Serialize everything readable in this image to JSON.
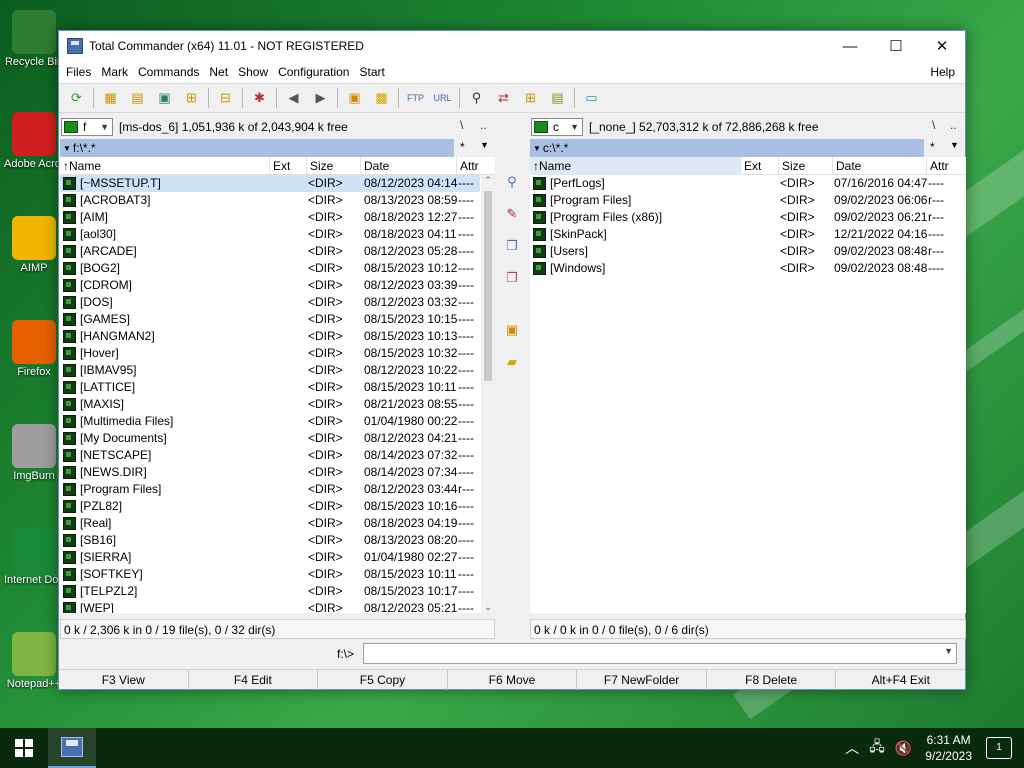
{
  "desktop": {
    "icons": [
      {
        "label": "Recycle Bin",
        "color": "#2f7d32"
      },
      {
        "label": "Adobe Acrobat",
        "color": "#d11f1f"
      },
      {
        "label": "AIMP",
        "color": "#f2b600"
      },
      {
        "label": "Firefox",
        "color": "#e66000"
      },
      {
        "label": "ImgBurn",
        "color": "#9e9e9e"
      },
      {
        "label": "Internet Download",
        "color": "#1a8a3a"
      },
      {
        "label": "Notepad++",
        "color": "#7fb542"
      }
    ]
  },
  "window": {
    "title": "Total Commander (x64) 11.01 - NOT REGISTERED",
    "controls": {
      "minimize": "—",
      "maximize": "☐",
      "close": "✕"
    }
  },
  "menu": {
    "items": [
      "Files",
      "Mark",
      "Commands",
      "Net",
      "Show",
      "Configuration",
      "Start"
    ],
    "help": "Help"
  },
  "toolbar": {
    "icons": [
      "refresh-icon",
      "brief-view-icon",
      "full-view-icon",
      "thumbnails-icon",
      "tree-icon",
      "invert-selection-icon",
      "compare-dirs-icon",
      "back-icon",
      "forward-icon",
      "pack-icon",
      "unpack-icon",
      "ftp-icon",
      "url-icon",
      "search-icon",
      "sync-dirs-icon",
      "multi-rename-icon",
      "copy-names-icon",
      "notepad-icon"
    ]
  },
  "left_panel": {
    "drive": "f",
    "drive_info": "[ms-dos_6]  1,051,936 k of 2,043,904 k free",
    "root_btn": "\\",
    "up_btn": "..",
    "path": "f:\\*.*",
    "filter": "*",
    "columns": {
      "name": "Name",
      "ext": "Ext",
      "size": "Size",
      "date": "Date",
      "attr": "Attr"
    },
    "files": [
      {
        "name": "[~MSSETUP.T]",
        "size": "<DIR>",
        "date": "08/12/2023 04:14",
        "attr": "----"
      },
      {
        "name": "[ACROBAT3]",
        "size": "<DIR>",
        "date": "08/13/2023 08:59",
        "attr": "----"
      },
      {
        "name": "[AIM]",
        "size": "<DIR>",
        "date": "08/18/2023 12:27",
        "attr": "----"
      },
      {
        "name": "[aol30]",
        "size": "<DIR>",
        "date": "08/18/2023 04:11",
        "attr": "----"
      },
      {
        "name": "[ARCADE]",
        "size": "<DIR>",
        "date": "08/12/2023 05:28",
        "attr": "----"
      },
      {
        "name": "[BOG2]",
        "size": "<DIR>",
        "date": "08/15/2023 10:12",
        "attr": "----"
      },
      {
        "name": "[CDROM]",
        "size": "<DIR>",
        "date": "08/12/2023 03:39",
        "attr": "----"
      },
      {
        "name": "[DOS]",
        "size": "<DIR>",
        "date": "08/12/2023 03:32",
        "attr": "----"
      },
      {
        "name": "[GAMES]",
        "size": "<DIR>",
        "date": "08/15/2023 10:15",
        "attr": "----"
      },
      {
        "name": "[HANGMAN2]",
        "size": "<DIR>",
        "date": "08/15/2023 10:13",
        "attr": "----"
      },
      {
        "name": "[Hover]",
        "size": "<DIR>",
        "date": "08/15/2023 10:32",
        "attr": "----"
      },
      {
        "name": "[IBMAV95]",
        "size": "<DIR>",
        "date": "08/12/2023 10:22",
        "attr": "----"
      },
      {
        "name": "[LATTICE]",
        "size": "<DIR>",
        "date": "08/15/2023 10:11",
        "attr": "----"
      },
      {
        "name": "[MAXIS]",
        "size": "<DIR>",
        "date": "08/21/2023 08:55",
        "attr": "----"
      },
      {
        "name": "[Multimedia Files]",
        "size": "<DIR>",
        "date": "01/04/1980 00:22",
        "attr": "----"
      },
      {
        "name": "[My Documents]",
        "size": "<DIR>",
        "date": "08/12/2023 04:21",
        "attr": "----"
      },
      {
        "name": "[NETSCAPE]",
        "size": "<DIR>",
        "date": "08/14/2023 07:32",
        "attr": "----"
      },
      {
        "name": "[NEWS.DIR]",
        "size": "<DIR>",
        "date": "08/14/2023 07:34",
        "attr": "----"
      },
      {
        "name": "[Program Files]",
        "size": "<DIR>",
        "date": "08/12/2023 03:44",
        "attr": "r---"
      },
      {
        "name": "[PZL82]",
        "size": "<DIR>",
        "date": "08/15/2023 10:16",
        "attr": "----"
      },
      {
        "name": "[Real]",
        "size": "<DIR>",
        "date": "08/18/2023 04:19",
        "attr": "----"
      },
      {
        "name": "[SB16]",
        "size": "<DIR>",
        "date": "08/13/2023 08:20",
        "attr": "----"
      },
      {
        "name": "[SIERRA]",
        "size": "<DIR>",
        "date": "01/04/1980 02:27",
        "attr": "----"
      },
      {
        "name": "[SOFTKEY]",
        "size": "<DIR>",
        "date": "08/15/2023 10:11",
        "attr": "----"
      },
      {
        "name": "[TELPZL2]",
        "size": "<DIR>",
        "date": "08/15/2023 10:17",
        "attr": "----"
      },
      {
        "name": "[WEP]",
        "size": "<DIR>",
        "date": "08/12/2023 05:21",
        "attr": "----"
      }
    ],
    "status": "0 k / 2,306 k in 0 / 19 file(s), 0 / 32 dir(s)"
  },
  "right_panel": {
    "drive": "c",
    "drive_info": "[_none_]  52,703,312 k of 72,886,268 k free",
    "root_btn": "\\",
    "up_btn": "..",
    "path": "c:\\*.*",
    "filter": "*",
    "columns": {
      "name": "Name",
      "ext": "Ext",
      "size": "Size",
      "date": "Date",
      "attr": "Attr"
    },
    "files": [
      {
        "name": "[PerfLogs]",
        "size": "<DIR>",
        "date": "07/16/2016 04:47",
        "attr": "----"
      },
      {
        "name": "[Program Files]",
        "size": "<DIR>",
        "date": "09/02/2023 06:06",
        "attr": "r---"
      },
      {
        "name": "[Program Files (x86)]",
        "size": "<DIR>",
        "date": "09/02/2023 06:21",
        "attr": "r---"
      },
      {
        "name": "[SkinPack]",
        "size": "<DIR>",
        "date": "12/21/2022 04:16",
        "attr": "----"
      },
      {
        "name": "[Users]",
        "size": "<DIR>",
        "date": "09/02/2023 08:48",
        "attr": "r---"
      },
      {
        "name": "[Windows]",
        "size": "<DIR>",
        "date": "09/02/2023 08:48",
        "attr": "----"
      }
    ],
    "status": "0 k / 0 k in 0 / 0 file(s), 0 / 6 dir(s)"
  },
  "middle_buttons": [
    "view-icon",
    "edit-icon",
    "copy-icon",
    "move-icon",
    "pack-icon",
    "new-folder-icon"
  ],
  "command_line": {
    "prompt": "f:\\>",
    "value": ""
  },
  "function_keys": [
    "F3 View",
    "F4 Edit",
    "F5 Copy",
    "F6 Move",
    "F7 NewFolder",
    "F8 Delete",
    "Alt+F4 Exit"
  ],
  "taskbar": {
    "time": "6:31 AM",
    "date": "9/2/2023",
    "notifications": "1"
  }
}
